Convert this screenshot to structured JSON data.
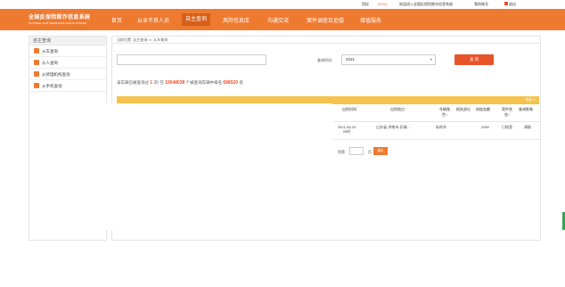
{
  "topbar": {
    "hello": "您好,",
    "user": "XXXX",
    "welcome": "欢迎进入全国反保险欺诈信息系统",
    "account": "我的账号",
    "logout": "退出"
  },
  "header": {
    "logo_title": "全国反保险欺诈信息系统",
    "logo_sub": "NATIONAL ANTI INSURANCE FRAUD SYSTEM",
    "nav": [
      "首页",
      "从业不良人员",
      "自主查询",
      "风险信息库",
      "沟通交流",
      "案件调查及追偿",
      "增值服务"
    ]
  },
  "sidebar": {
    "title": "自主查询",
    "items": [
      "从车查询",
      "从人查询",
      "从修理机构查询",
      "从手机查询"
    ]
  },
  "main": {
    "breadcrumb": "当前位置: 自主查询 >> 从车查询",
    "search_placeholder": "",
    "time_label": "查询时间:",
    "time_value": "2021",
    "query_button": "查 询",
    "stats": {
      "prefix": "该车辆已被查询过",
      "count1": "1",
      "mid1": "次! 在",
      "count2": "10648038",
      "mid2": "个被查询车辆中排名",
      "count3": "698520",
      "suffix": "名"
    },
    "table": {
      "more": "更多>>",
      "headers": [
        "出险时间",
        "出险地点",
        "车辆角色↑",
        "损失部位",
        "核赔金额",
        "案件状态↑",
        "查询影像"
      ],
      "row": [
        "2021-08-20 09时",
        "山东省-济南市-历城...",
        "标的车",
        "",
        "2550",
        "已结案",
        "调取"
      ]
    },
    "pager": {
      "label": "到第",
      "page": "页",
      "go": "确定"
    }
  },
  "colors": {
    "accent": "#ee7a30",
    "button": "#e8532a",
    "table_bar": "#f5c34d"
  }
}
